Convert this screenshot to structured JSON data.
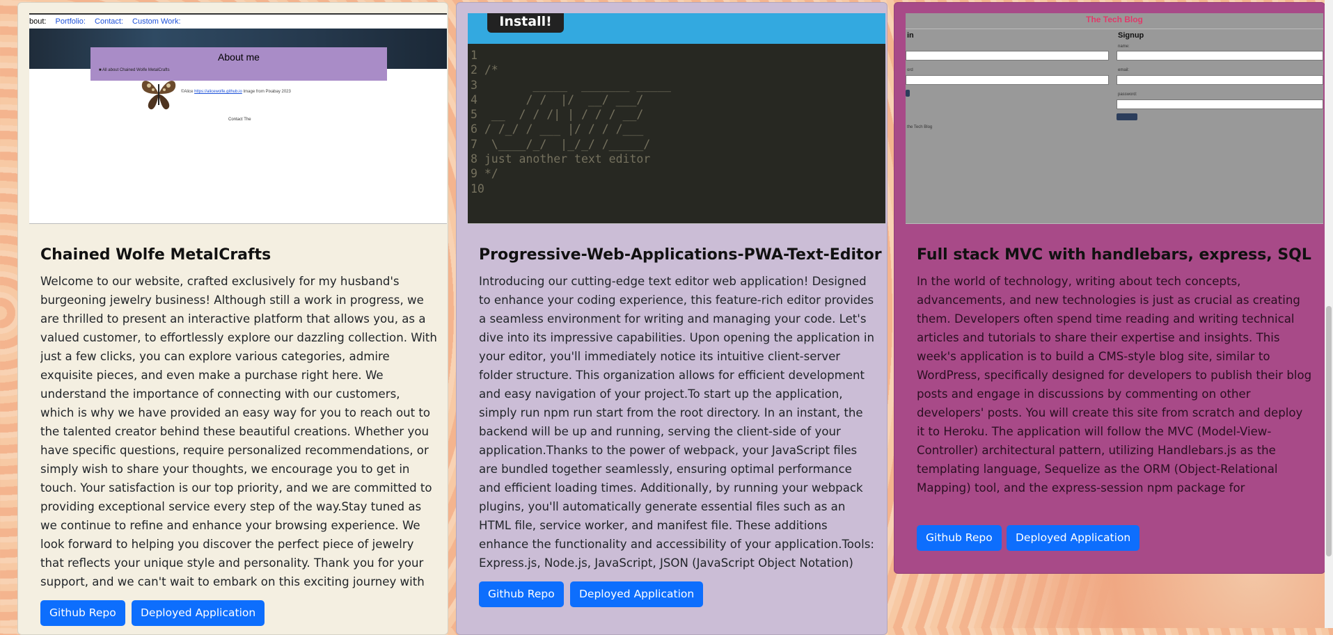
{
  "colors": {
    "card1": "#f4efe1",
    "card2": "#cbbdd6",
    "card3": "#a84a88",
    "button": "#0d6efd"
  },
  "cards": [
    {
      "screenshot": {
        "nav": [
          "bout:",
          "Portfolio:",
          "Contact:",
          "Custom Work:"
        ],
        "about_title": "About me",
        "about_sub": "■ All about Chained Wolfe MetalCrafts",
        "credit_prefix": "©Alice ",
        "credit_link": "https://alicewolfe.github.io",
        "credit_suffix": " Image from Pixabay 2023",
        "contact": "Contact The"
      },
      "title": "Chained Wolfe MetalCrafts",
      "description": "Welcome to our website, crafted exclusively for my husband's burgeoning jewelry business! Although still a work in progress, we are thrilled to present an interactive platform that allows you, as a valued customer, to effortlessly explore our dazzling collection. With just a few clicks, you can explore various categories, admire exquisite pieces, and even make a purchase right here. We understand the importance of connecting with our customers, which is why we have provided an easy way for you to reach out to the talented creator behind these beautiful creations. Whether you have specific questions, require personalized recommendations, or simply wish to share your thoughts, we encourage you to get in touch. Your satisfaction is our top priority, and we are committed to providing exceptional service every step of the way.Stay tuned as we continue to refine and enhance your browsing experience. We look forward to helping you discover the perfect piece of jewelry that reflects your unique style and personality. Thank you for your support, and we can't wait to embark on this exciting journey with you..React, Heroku,",
      "github_label": "Github Repo",
      "deployed_label": "Deployed Application"
    },
    {
      "screenshot": {
        "install_label": "Install!",
        "code": "1\n2 /*\n3        _____  _______ _____\n4       / /  |/  __/ ___/\n5  __  / / /| | / / / __/\n6 / /_/ / ___ |/ / / /___\n7  \\____/_/  |_/_/ /_____/\n8 just another text editor\n9 */\n10"
      },
      "title": "Progressive-Web-Applications-PWA-Text-Editor",
      "description": "Introducing our cutting-edge text editor web application! Designed to enhance your coding experience, this feature-rich editor provides a seamless environment for writing and managing your code. Let's dive into its impressive capabilities. Upon opening the application in your editor, you'll immediately notice its intuitive client-server folder structure. This organization allows for efficient development and easy navigation of your project.To start up the application, simply run npm run start from the root directory. In an instant, the backend will be up and running, serving the client-side of your application.Thanks to the power of webpack, your JavaScript files are bundled together seamlessly, ensuring optimal performance and efficient loading times. Additionally, by running your webpack plugins, you'll automatically generate essential files such as an HTML file, service worker, and manifest file. These additions enhance the functionality and accessibility of your application.Tools: Express.js, Node.js, JavaScript, JSON (JavaScript Object Notation)",
      "github_label": "Github Repo",
      "deployed_label": "Deployed Application"
    },
    {
      "screenshot": {
        "blog_title": "The Tech Blog",
        "login_heading": "in",
        "signup_heading": "Signup",
        "username_label": "name:",
        "email_label": "email:",
        "password_label": "password:",
        "login_email_label": "ord",
        "footer": "the Tech Blog"
      },
      "title": "Full stack MVC with handlebars, express, SQL",
      "description": "In the world of technology, writing about tech concepts, advancements, and new technologies is just as crucial as creating them. Developers often spend time reading and writing technical articles and tutorials to share their expertise and insights. This week's application is to build a CMS-style blog site, similar to WordPress, specifically designed for developers to publish their blog posts and engage in discussions by commenting on other developers' posts. You will create this site from scratch and deploy it to Heroku. The application will follow the MVC (Model-View-Controller) architectural pattern, utilizing Handlebars.js as the templating language, Sequelize as the ORM (Object-Relational Mapping) tool, and the express-session npm package for authentication.Express.js, APIs, Handlebars.js, Sequelize, Heroku.",
      "github_label": "Github Repo",
      "deployed_label": "Deployed Application"
    }
  ]
}
